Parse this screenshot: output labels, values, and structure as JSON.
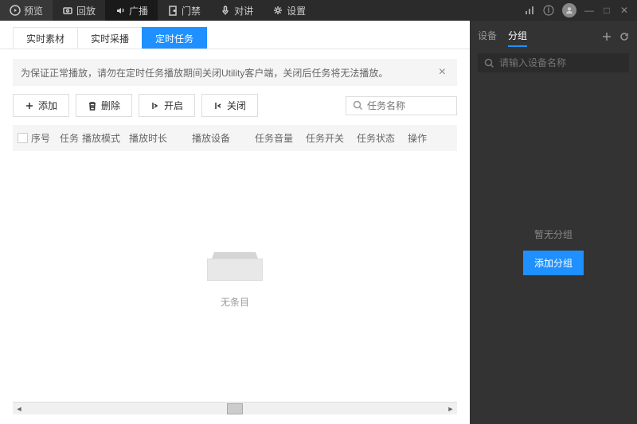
{
  "topnav": [
    {
      "label": "预览"
    },
    {
      "label": "回放"
    },
    {
      "label": "广播",
      "active": true
    },
    {
      "label": "门禁"
    },
    {
      "label": "对讲"
    },
    {
      "label": "设置"
    }
  ],
  "tabs": [
    {
      "label": "实时素材"
    },
    {
      "label": "实时采播"
    },
    {
      "label": "定时任务",
      "active": true
    }
  ],
  "notice": {
    "text": "为保证正常播放，请勿在定时任务播放期间关闭Utility客户端，关闭后任务将无法播放。"
  },
  "toolbar": {
    "add": "添加",
    "delete": "删除",
    "open": "开启",
    "close": "关闭",
    "search_placeholder": "任务名称"
  },
  "columns": [
    "序号",
    "任务",
    "播放模式",
    "播放时长",
    "播放设备",
    "任务音量",
    "任务开关",
    "任务状态",
    "操作"
  ],
  "empty": {
    "label": "无条目"
  },
  "side": {
    "tabs": [
      {
        "label": "设备"
      },
      {
        "label": "分组",
        "active": true
      }
    ],
    "search_placeholder": "请输入设备名称",
    "empty_text": "暂无分组",
    "add_btn": "添加分组"
  }
}
